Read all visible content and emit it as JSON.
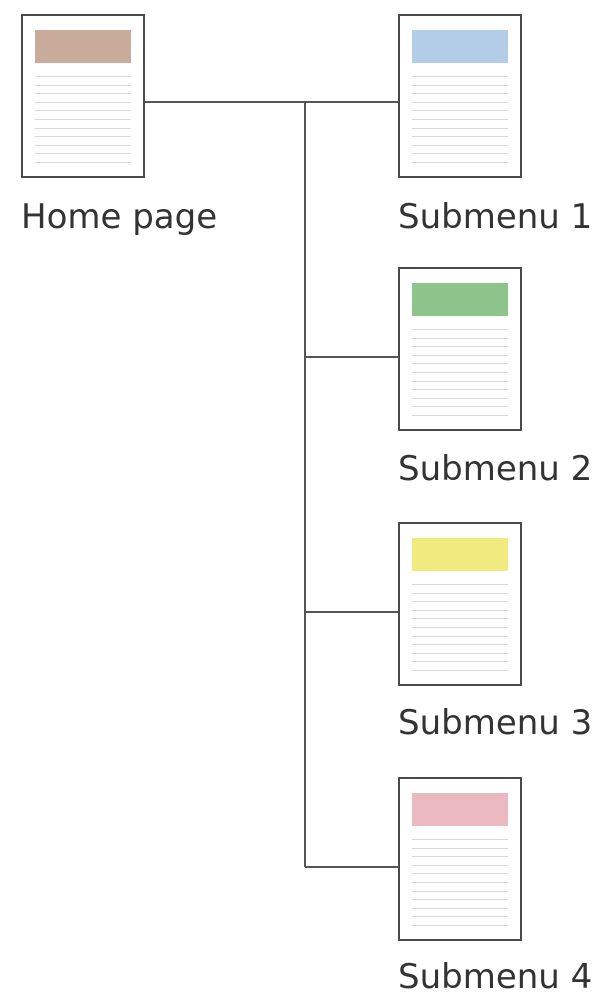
{
  "nodes": {
    "home": {
      "label": "Home page",
      "color": "#c9ab9b"
    },
    "submenu_1": {
      "label": "Submenu 1",
      "color": "#b3cce8"
    },
    "submenu_2": {
      "label": "Submenu 2",
      "color": "#8cc48c"
    },
    "submenu_3": {
      "label": "Submenu 3",
      "color": "#f0ea7f"
    },
    "submenu_4": {
      "label": "Submenu 4",
      "color": "#ebb9c0"
    }
  },
  "line_color": "#555555"
}
